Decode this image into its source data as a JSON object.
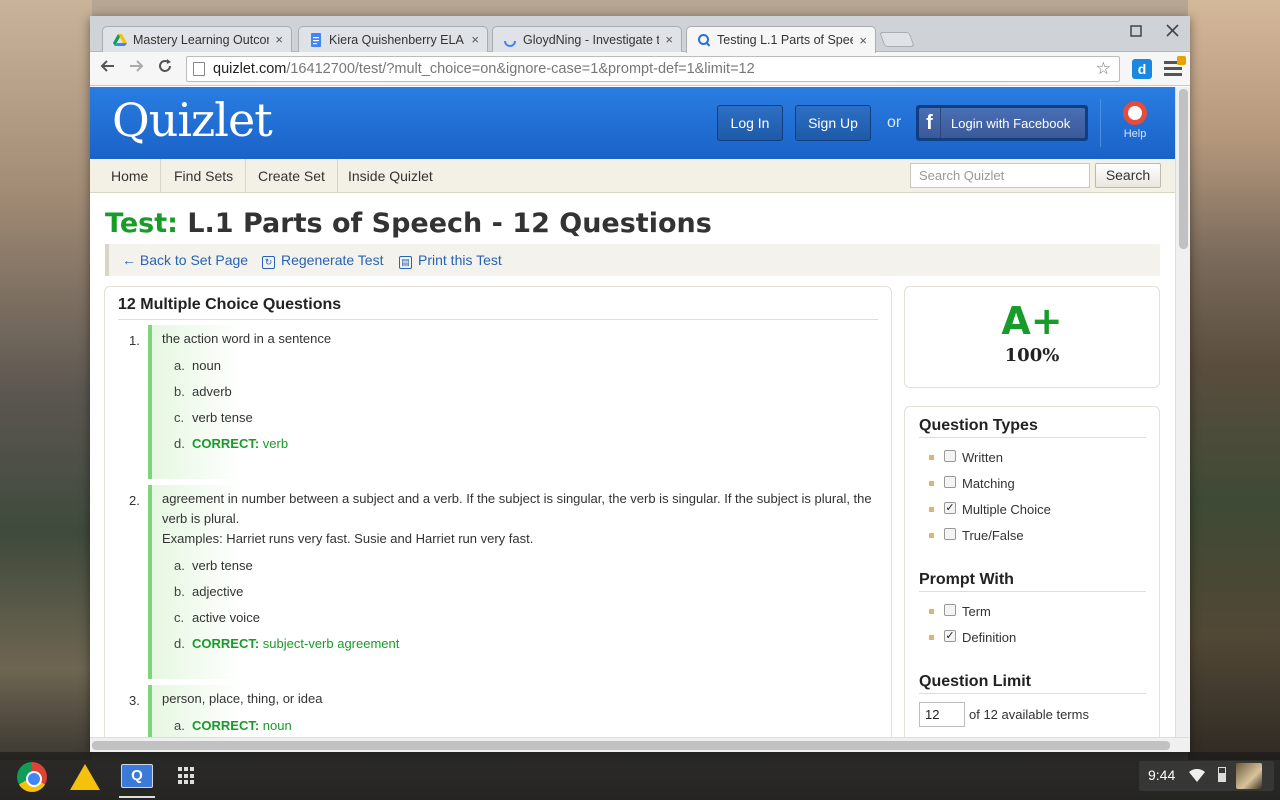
{
  "browser": {
    "tabs": [
      {
        "title": "Mastery Learning Outcom",
        "icon": "drive-icon"
      },
      {
        "title": "Kiera Quishenberry ELA",
        "icon": "docs-icon"
      },
      {
        "title": "GloydNing - Investigate t",
        "icon": "loading-icon"
      },
      {
        "title": "Testing L.1 Parts of Spee",
        "icon": "quizlet-icon"
      }
    ],
    "close_glyph": "×",
    "url_host": "quizlet.com",
    "url_path": "/16412700/test/?mult_choice=on&ignore-case=1&prompt-def=1&limit=12",
    "ext_label": "d"
  },
  "header": {
    "logo": "Quizlet",
    "login": "Log In",
    "signup": "Sign Up",
    "or": "or",
    "facebook": "Login with Facebook",
    "help": "Help"
  },
  "nav": {
    "items": [
      "Home",
      "Find Sets",
      "Create Set",
      "Inside Quizlet"
    ],
    "search_placeholder": "Search Quizlet",
    "search_button": "Search"
  },
  "page": {
    "title_prefix": "Test:",
    "title": "L.1 Parts of Speech - 12 Questions",
    "actions": [
      "← Back to Set Page",
      "Regenerate Test",
      "Print this Test"
    ]
  },
  "questions": {
    "heading": "12 Multiple Choice Questions",
    "correct_label": "CORRECT:",
    "items": [
      {
        "num": "1.",
        "text": "the action word in a sentence",
        "options": [
          {
            "letter": "a.",
            "text": "noun"
          },
          {
            "letter": "b.",
            "text": "adverb"
          },
          {
            "letter": "c.",
            "text": "verb tense"
          },
          {
            "letter": "d.",
            "text": "verb",
            "correct": true
          }
        ]
      },
      {
        "num": "2.",
        "text_line1": "agreement in number between a subject and a verb. If the subject is singular, the verb is singular. If the subject is plural, the",
        "text_line2": "verb is plural.",
        "text_line3": "Examples: Harriet runs very fast. Susie and Harriet run very fast.",
        "options": [
          {
            "letter": "a.",
            "text": "verb tense"
          },
          {
            "letter": "b.",
            "text": "adjective"
          },
          {
            "letter": "c.",
            "text": "active voice"
          },
          {
            "letter": "d.",
            "text": "subject-verb agreement",
            "correct": true
          }
        ]
      },
      {
        "num": "3.",
        "text": "person, place, thing, or idea",
        "options": [
          {
            "letter": "a.",
            "text": "noun",
            "correct": true
          }
        ]
      }
    ]
  },
  "score": {
    "grade": "A+",
    "percent": "100%"
  },
  "settings": {
    "question_types_heading": "Question Types",
    "question_types": [
      {
        "label": "Written",
        "checked": false
      },
      {
        "label": "Matching",
        "checked": false
      },
      {
        "label": "Multiple Choice",
        "checked": true
      },
      {
        "label": "True/False",
        "checked": false
      }
    ],
    "prompt_heading": "Prompt With",
    "prompt_with": [
      {
        "label": "Term",
        "checked": false
      },
      {
        "label": "Definition",
        "checked": true
      }
    ],
    "limit_heading": "Question Limit",
    "limit_value": "12",
    "limit_suffix": "of 12 available terms"
  },
  "shelf": {
    "quizlet_app_label": "Q",
    "time": "9:44"
  }
}
